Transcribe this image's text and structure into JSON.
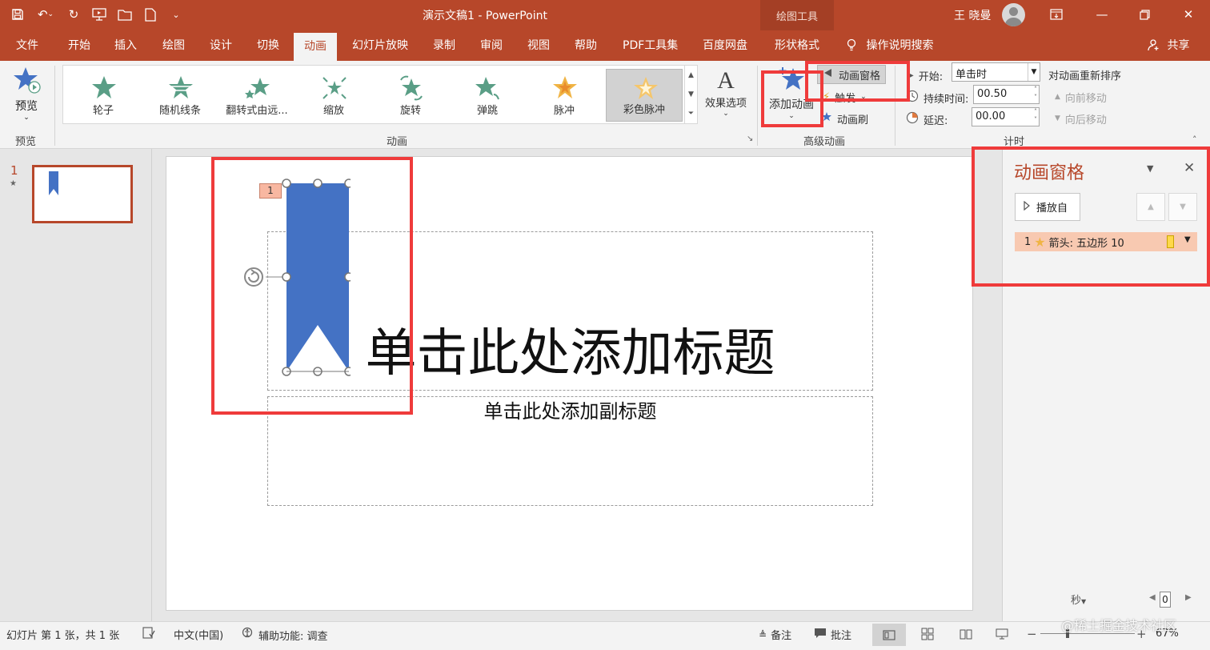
{
  "window": {
    "title": "演示文稿1  -  PowerPoint",
    "contextual_tab_group": "绘图工具",
    "user_name": "王 晓曼"
  },
  "menu": {
    "tabs": [
      {
        "label": "文件",
        "active": false
      },
      {
        "label": "开始",
        "active": false
      },
      {
        "label": "插入",
        "active": false
      },
      {
        "label": "绘图",
        "active": false
      },
      {
        "label": "设计",
        "active": false
      },
      {
        "label": "切换",
        "active": false
      },
      {
        "label": "动画",
        "active": true
      },
      {
        "label": "幻灯片放映",
        "active": false
      },
      {
        "label": "录制",
        "active": false
      },
      {
        "label": "审阅",
        "active": false
      },
      {
        "label": "视图",
        "active": false
      },
      {
        "label": "帮助",
        "active": false
      },
      {
        "label": "PDF工具集",
        "active": false
      },
      {
        "label": "百度网盘",
        "active": false
      },
      {
        "label": "形状格式",
        "active": false
      }
    ],
    "tell_me": "操作说明搜索",
    "share": "共享"
  },
  "ribbon": {
    "preview": {
      "button": "预览",
      "group": "预览"
    },
    "animation": {
      "group": "动画",
      "effects": [
        {
          "label": "轮子",
          "selected": false
        },
        {
          "label": "随机线条",
          "selected": false
        },
        {
          "label": "翻转式由远...",
          "selected": false
        },
        {
          "label": "缩放",
          "selected": false
        },
        {
          "label": "旋转",
          "selected": false
        },
        {
          "label": "弹跳",
          "selected": false
        },
        {
          "label": "脉冲",
          "selected": false
        },
        {
          "label": "彩色脉冲",
          "selected": true
        }
      ],
      "effect_options": "效果选项"
    },
    "advanced": {
      "group": "高级动画",
      "add_animation": "添加动画",
      "animation_pane": "动画窗格",
      "trigger": "触发",
      "animation_painter": "动画刷"
    },
    "timing": {
      "group": "计时",
      "start_label": "开始:",
      "start_value": "单击时",
      "duration_label": "持续时间:",
      "duration_value": "00.50",
      "delay_label": "延迟:",
      "delay_value": "00.00",
      "reorder_title": "对动画重新排序",
      "move_earlier": "向前移动",
      "move_later": "向后移动"
    }
  },
  "thumbnails": [
    {
      "number": "1"
    }
  ],
  "slide": {
    "title_placeholder": "单击此处添加标题",
    "subtitle_placeholder": "单击此处添加副标题",
    "animation_tag": "1"
  },
  "animation_pane": {
    "title": "动画窗格",
    "play_from": "播放自",
    "items": [
      {
        "number": "1",
        "name": "箭头: 五边形 10"
      }
    ],
    "time_unit": "秒",
    "timeline_value": "0"
  },
  "status": {
    "slide_info": "幻灯片 第 1 张，共 1 张",
    "language": "中文(中国)",
    "accessibility": "辅助功能: 调查",
    "notes": "备注",
    "comments": "批注",
    "zoom": "67%",
    "watermark": "@稀土掘金技术社区"
  }
}
